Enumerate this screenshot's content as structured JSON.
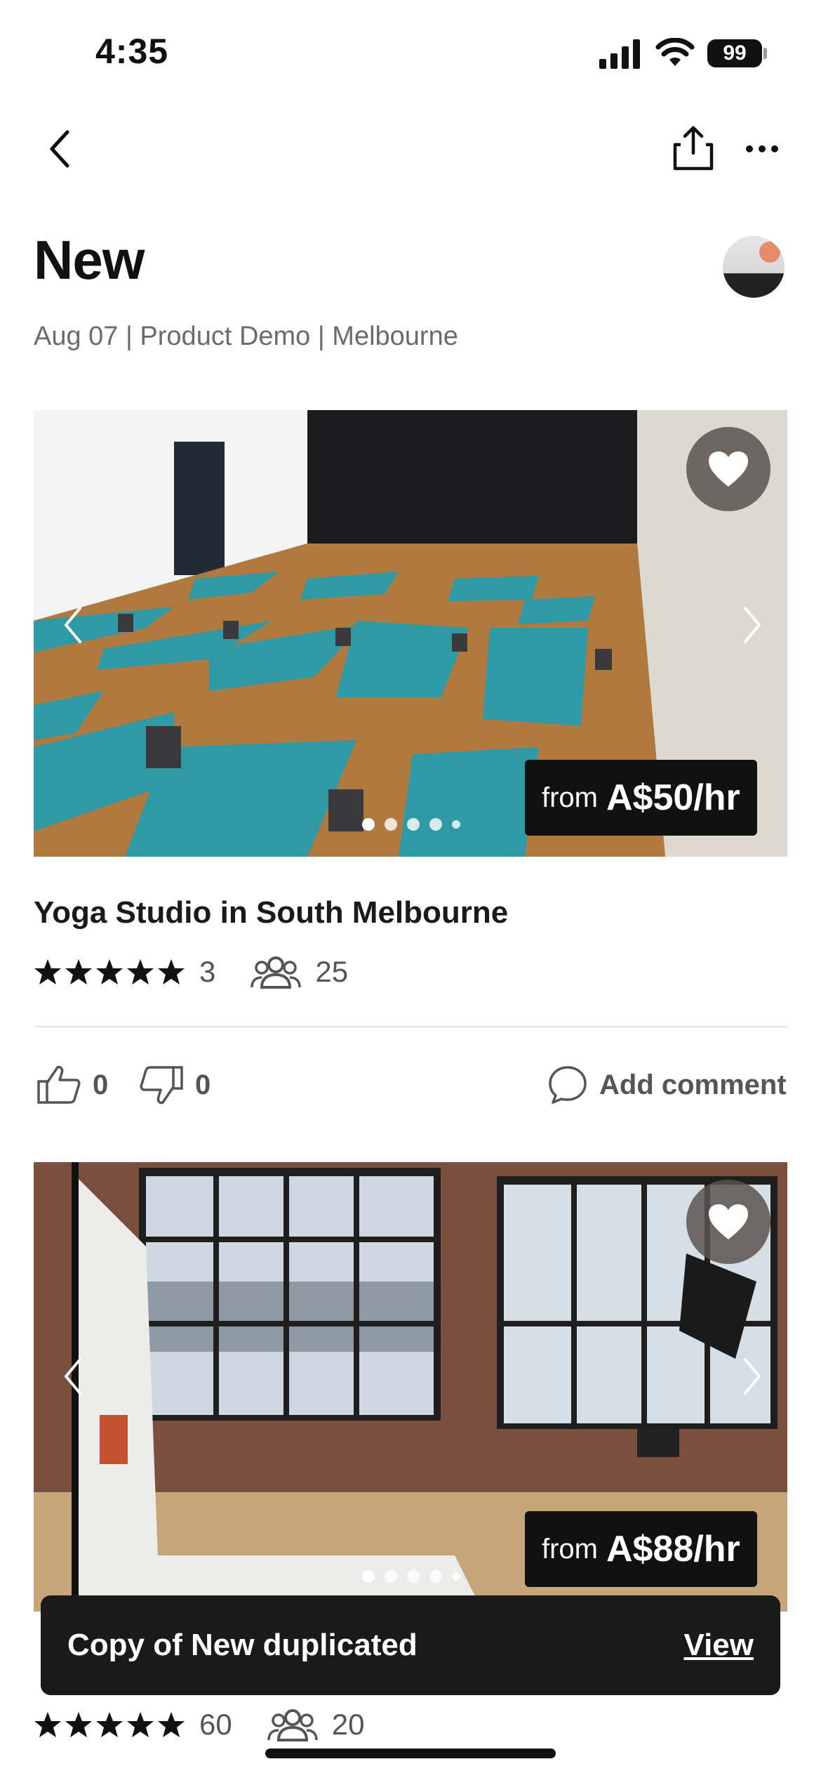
{
  "status_bar": {
    "time": "4:35",
    "battery": "99"
  },
  "header": {
    "title": "New",
    "subtitle": "Aug 07 | Product Demo | Melbourne"
  },
  "listings": [
    {
      "title": "Yoga Studio in South Melbourne",
      "price_prefix": "from",
      "price": "A$50/hr",
      "rating_stars": 5,
      "reviews": "3",
      "capacity": "25",
      "likes": "0",
      "dislikes": "0",
      "comment_label": "Add comment",
      "carousel_dots": 5,
      "carousel_active": 1
    },
    {
      "title": "",
      "price_prefix": "from",
      "price": "A$88/hr",
      "rating_stars": 5,
      "reviews": "60",
      "capacity": "20",
      "carousel_dots": 5,
      "carousel_active": 1
    }
  ],
  "toast": {
    "message": "Copy of New duplicated",
    "action": "View"
  },
  "colors": {
    "accent": "#111111",
    "mat": "#2f9aa6",
    "floor": "#b07a3f",
    "muted": "#6b6b6b"
  },
  "icons": [
    "back-icon",
    "share-icon",
    "more-icon",
    "heart-icon",
    "star-icon",
    "people-icon",
    "thumbs-up-icon",
    "thumbs-down-icon",
    "comment-icon"
  ]
}
